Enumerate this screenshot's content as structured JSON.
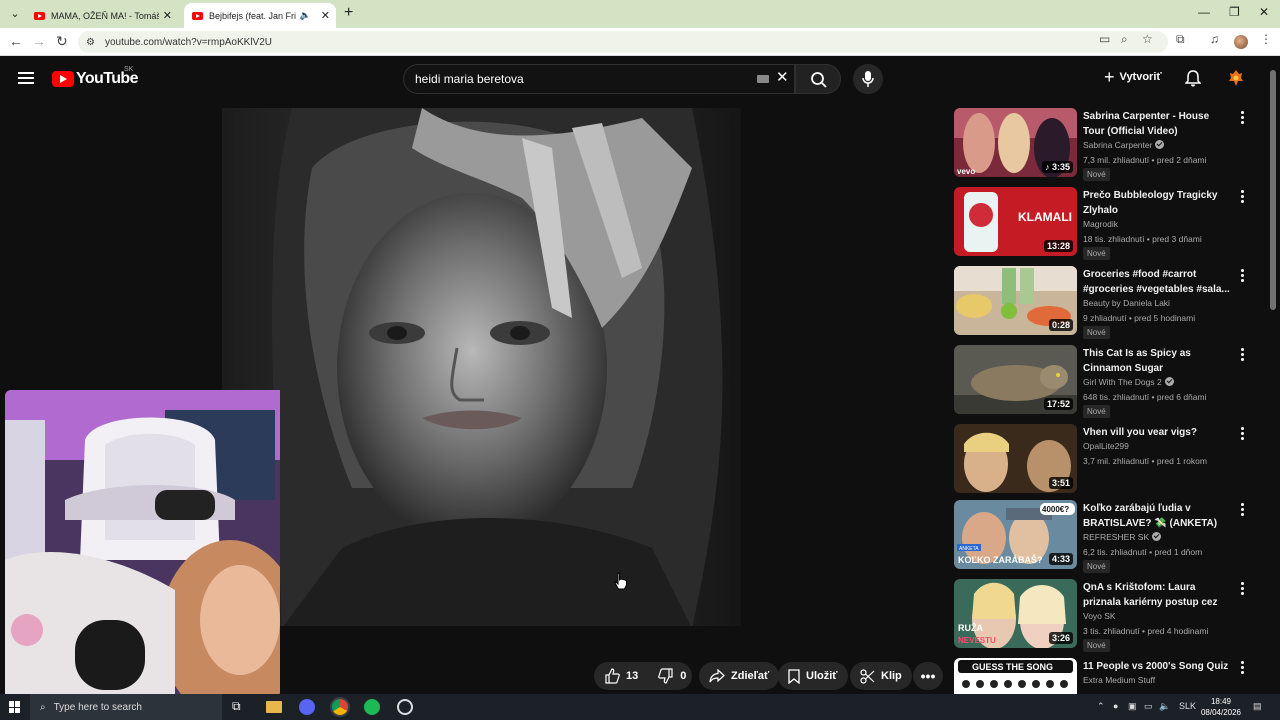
{
  "browser": {
    "tabs": [
      {
        "title": "MAMA, OŽEŇ MA! - Tomáš (1...",
        "active": false
      },
      {
        "title": "Bejbifejs (feat. Jan Fridrich)",
        "active": true
      }
    ],
    "url": "youtube.com/watch?v=rmpAoKKlV2U"
  },
  "youtube": {
    "logo_text": "YouTube",
    "country_code": "SK",
    "search_query": "heidi maria beretova",
    "create_label": "Vytvoriť"
  },
  "actions": {
    "likes": "13",
    "dislikes": "0",
    "share": "Zdieľať",
    "save": "Uložiť",
    "clip": "Klip"
  },
  "recommendations": [
    {
      "title": "Sabrina Carpenter - House Tour (Official Video)",
      "channel": "Sabrina Carpenter",
      "verified": true,
      "stats": "7,3 mil. zhliadnutí • pred 2 dňami",
      "duration": "3:35",
      "badge": "Nové"
    },
    {
      "title": "Prečo Bubbleology Tragicky Zlyhalo",
      "channel": "Magrodik",
      "verified": false,
      "stats": "18 tis. zhliadnutí • pred 3 dňami",
      "duration": "13:28",
      "badge": "Nové"
    },
    {
      "title": "Groceries #food #carrot #groceries #vegetables #sala...",
      "channel": "Beauty by Daniela Laki",
      "verified": false,
      "stats": "9 zhliadnutí • pred 5 hodinami",
      "duration": "0:28",
      "badge": "Nové"
    },
    {
      "title": "This Cat Is as Spicy as Cinnamon Sugar",
      "channel": "Girl With The Dogs 2",
      "verified": true,
      "stats": "648 tis. zhliadnutí • pred 6 dňami",
      "duration": "17:52",
      "badge": "Nové"
    },
    {
      "title": "Vhen vill you vear vigs?",
      "channel": "OpalLite299",
      "verified": false,
      "stats": "3,7 mil. zhliadnutí • pred 1 rokom",
      "duration": "3:51",
      "badge": ""
    },
    {
      "title": "Koľko zarábajú ľudia v BRATISLAVE? 💸 (ANKETA)",
      "channel": "REFRESHER SK",
      "verified": true,
      "stats": "6,2 tis. zhliadnutí • pred 1 dňom",
      "duration": "4:33",
      "badge": "Nové"
    },
    {
      "title": "QnA s Krištofom: Laura priznala kariérny postup cez posteľ🌹 | ...",
      "channel": "Voyo SK",
      "verified": false,
      "stats": "3 tis. zhliadnutí • pred 4 hodinami",
      "duration": "3:26",
      "badge": "Nové"
    },
    {
      "title": "11 People vs 2000's Song Quiz",
      "channel": "Extra Medium Stuff",
      "verified": false,
      "stats": "",
      "duration": "",
      "badge": ""
    }
  ],
  "thumb_text": {
    "t1": "vevo",
    "t2": "KLAMALI",
    "t6a": "4000€?",
    "t6b": "KOĽKO ZARÁBAŠ?",
    "t6c": "ANKETA",
    "t7a": "RUŽA",
    "t7b": "NEVESTU",
    "t8": "GUESS THE SONG"
  },
  "taskbar": {
    "search_placeholder": "Type here to search",
    "language": "SLK",
    "time": "18:49",
    "date": "08/04/2026"
  }
}
